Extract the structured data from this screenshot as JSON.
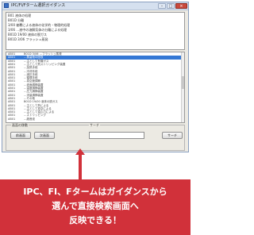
{
  "window": {
    "title": "IPC/FI/Fターム選択ガイダンス",
    "min_glyph": "–",
    "max_glyph": "□",
    "close_glyph": "×"
  },
  "header": {
    "lines": [
      "B01 液体の処理",
      "B01D 分離",
      "3/00 被覆による液体の化学的・物理的処理",
      "3/06 …液中の溶解気体の分離による処理",
      "B01D 19/00 液体の脱ガス",
      "B01D 3/06 フラッシュ蒸発"
    ]
  },
  "list": {
    "rows": [
      {
        "code": "AB01",
        "text": "B01D 3/06 …フラッシュ蒸発",
        "selected": false
      },
      {
        "code": "AB01",
        "text": "…蒸留液の回収",
        "selected": true
      },
      {
        "code": "AB01",
        "text": "…主として有機ガス",
        "selected": false
      },
      {
        "code": "AB01",
        "text": "…主として熱ストリッピング装置",
        "selected": false
      },
      {
        "code": "AB01",
        "text": "…加熱手段",
        "selected": false
      },
      {
        "code": "AB01",
        "text": "…冷却手段",
        "selected": false
      },
      {
        "code": "AB01",
        "text": "…減圧手段",
        "selected": false
      },
      {
        "code": "AB01",
        "text": "…循環手段",
        "selected": false
      },
      {
        "code": "AB01",
        "text": "…真空度調節",
        "selected": false
      },
      {
        "code": "AB01",
        "text": "…液面調節装置",
        "selected": false
      },
      {
        "code": "AB01",
        "text": "…温度調節装置",
        "selected": false
      },
      {
        "code": "AB01",
        "text": "…圧力調節装置",
        "selected": false
      },
      {
        "code": "AB01",
        "text": "…流量調節装置",
        "selected": false
      },
      {
        "code": "AB01",
        "text": "…その他",
        "selected": false
      },
      {
        "code": "AB01",
        "text": "B01D 19/00 液体の脱ガス",
        "selected": false
      },
      {
        "code": "AB01",
        "text": "…主として熱による",
        "selected": false
      },
      {
        "code": "AB01",
        "text": "…主として真空による",
        "selected": false
      },
      {
        "code": "AB01",
        "text": "…主として遠心力による",
        "selected": false
      },
      {
        "code": "AB01",
        "text": "…ストリッピング",
        "selected": false
      },
      {
        "code": "AB01",
        "text": "…超音波",
        "selected": false
      }
    ]
  },
  "controls": {
    "group_label": "画面の移動",
    "search_label": "サーチ",
    "prev_button": "前画面",
    "next_button": "次画面",
    "search_button": "サーチ"
  },
  "banner": {
    "line1": "IPC、FI、Fタームはガイダンスから",
    "line2": "選んで直接検索画面へ",
    "line3": "反映できる！"
  },
  "colors": {
    "banner": "#d1313a",
    "selection": "#3478d4"
  }
}
